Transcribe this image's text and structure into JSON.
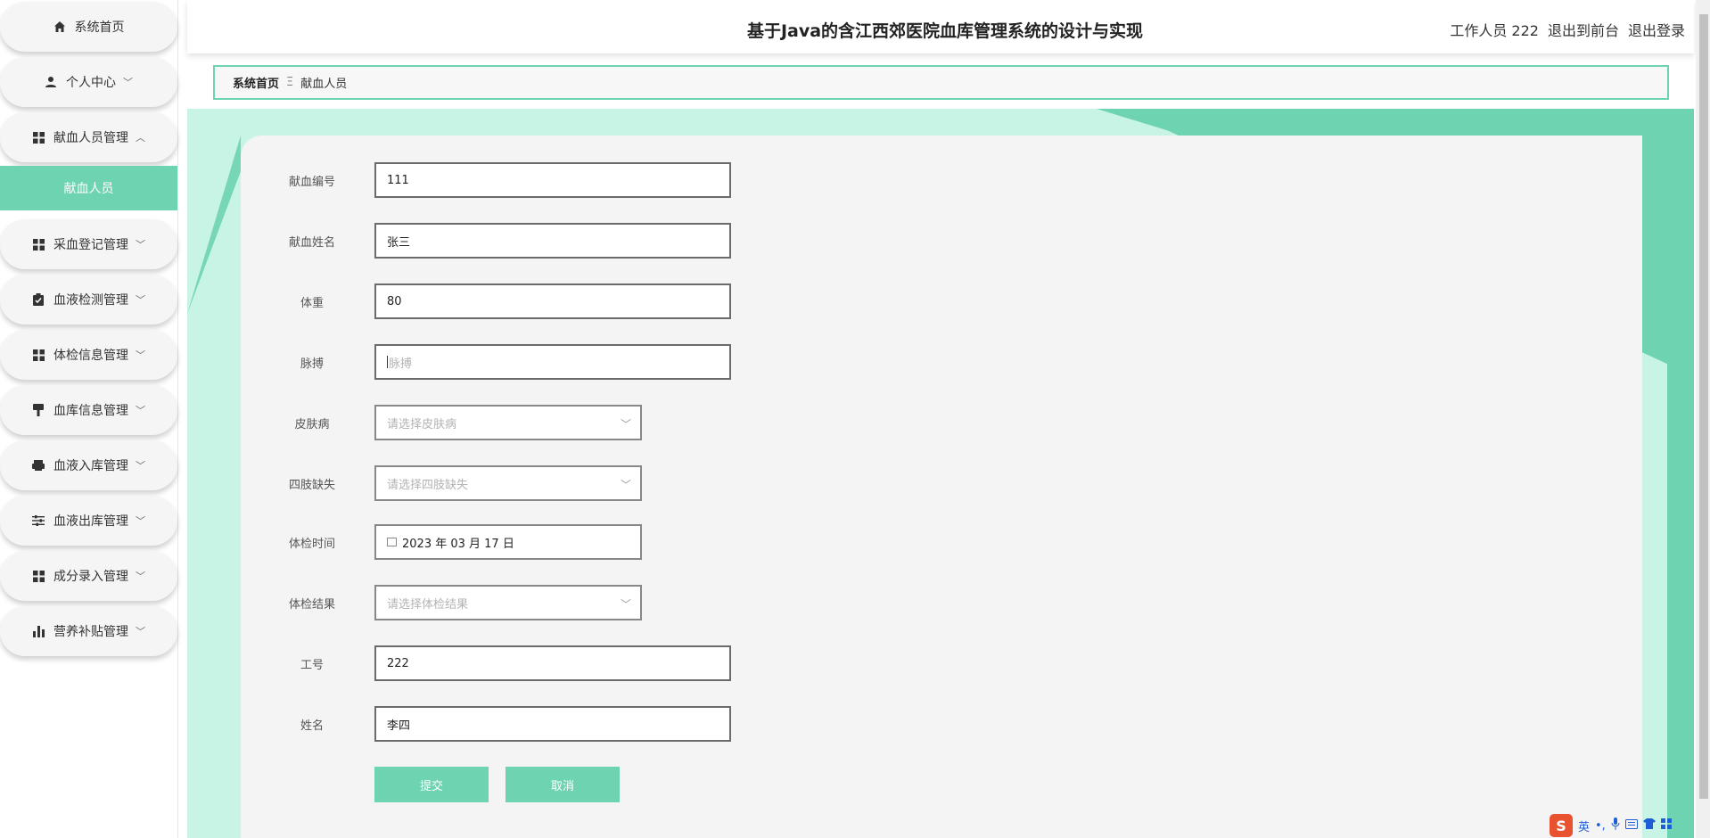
{
  "sidebar": {
    "home": "系统首页",
    "items": [
      {
        "label": "个人中心",
        "icon": "user-icon"
      },
      {
        "label": "献血人员管理",
        "icon": "grid-icon"
      },
      {
        "label": "采血登记管理",
        "icon": "grid-icon"
      },
      {
        "label": "血液检测管理",
        "icon": "clipboard-icon"
      },
      {
        "label": "体检信息管理",
        "icon": "grid-icon"
      },
      {
        "label": "血库信息管理",
        "icon": "brush-icon"
      },
      {
        "label": "血液入库管理",
        "icon": "printer-icon"
      },
      {
        "label": "血液出库管理",
        "icon": "sliders-icon"
      },
      {
        "label": "成分录入管理",
        "icon": "grid-icon"
      },
      {
        "label": "营养补贴管理",
        "icon": "bar-chart-icon"
      }
    ],
    "active_sub": "献血人员"
  },
  "header": {
    "title": "基于Java的含江西郊医院血库管理系统的设计与实现",
    "user": "工作人员 222",
    "to_front": "退出到前台",
    "logout": "退出登录"
  },
  "breadcrumb": {
    "home": "系统首页",
    "sep": "Ξ",
    "current": "献血人员"
  },
  "form": {
    "fields": [
      {
        "label": "献血编号",
        "value": "111"
      },
      {
        "label": "献血姓名",
        "value": "张三"
      },
      {
        "label": "体重",
        "value": "80"
      },
      {
        "label": "脉搏",
        "placeholder": "脉搏"
      },
      {
        "label": "皮肤病",
        "placeholder": "请选择皮肤病"
      },
      {
        "label": "四肢缺失",
        "placeholder": "请选择四肢缺失"
      },
      {
        "label": "体检时间",
        "value": "2023 年 03 月 17 日"
      },
      {
        "label": "体检结果",
        "placeholder": "请选择体检结果"
      },
      {
        "label": "工号",
        "value": "222"
      },
      {
        "label": "姓名",
        "value": "李四"
      }
    ],
    "submit": "提交",
    "cancel": "取消"
  },
  "ime": {
    "lang": "英",
    "punct": "•,"
  },
  "colors": {
    "accent": "#6dd3b0",
    "background_light": "#c8f4e6"
  }
}
